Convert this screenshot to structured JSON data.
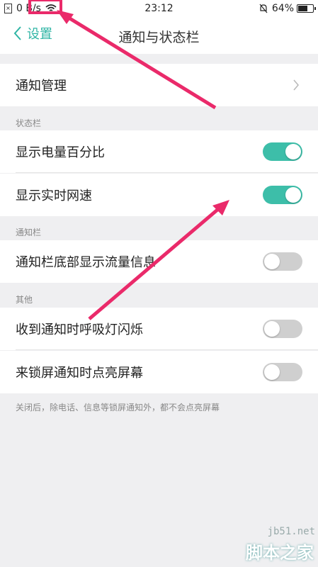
{
  "status_bar": {
    "net_speed": "0 B/s",
    "time": "23:12",
    "battery": "64%",
    "battery_level": 0.64
  },
  "header": {
    "back_label": "设置",
    "title": "通知与状态栏"
  },
  "rows": {
    "notification_mgmt": "通知管理",
    "battery_percent": "显示电量百分比",
    "realtime_speed": "显示实时网速",
    "traffic_info": "通知栏底部显示流量信息",
    "breathing_light": "收到通知时呼吸灯闪烁",
    "lock_wake": "来锁屏通知时点亮屏幕"
  },
  "toggles": {
    "battery_percent": true,
    "realtime_speed": true,
    "traffic_info": false,
    "breathing_light": false,
    "lock_wake": false
  },
  "sections": {
    "status_bar": "状态栏",
    "notification_bar": "通知栏",
    "other": "其他"
  },
  "footnote": "关闭后，除电话、信息等锁屏通知外，都不会点亮屏幕",
  "watermark": {
    "site": "jb51.net",
    "name": "脚本之家"
  },
  "colors": {
    "accent": "#3dbea9",
    "annotation": "#ea2a6a"
  }
}
